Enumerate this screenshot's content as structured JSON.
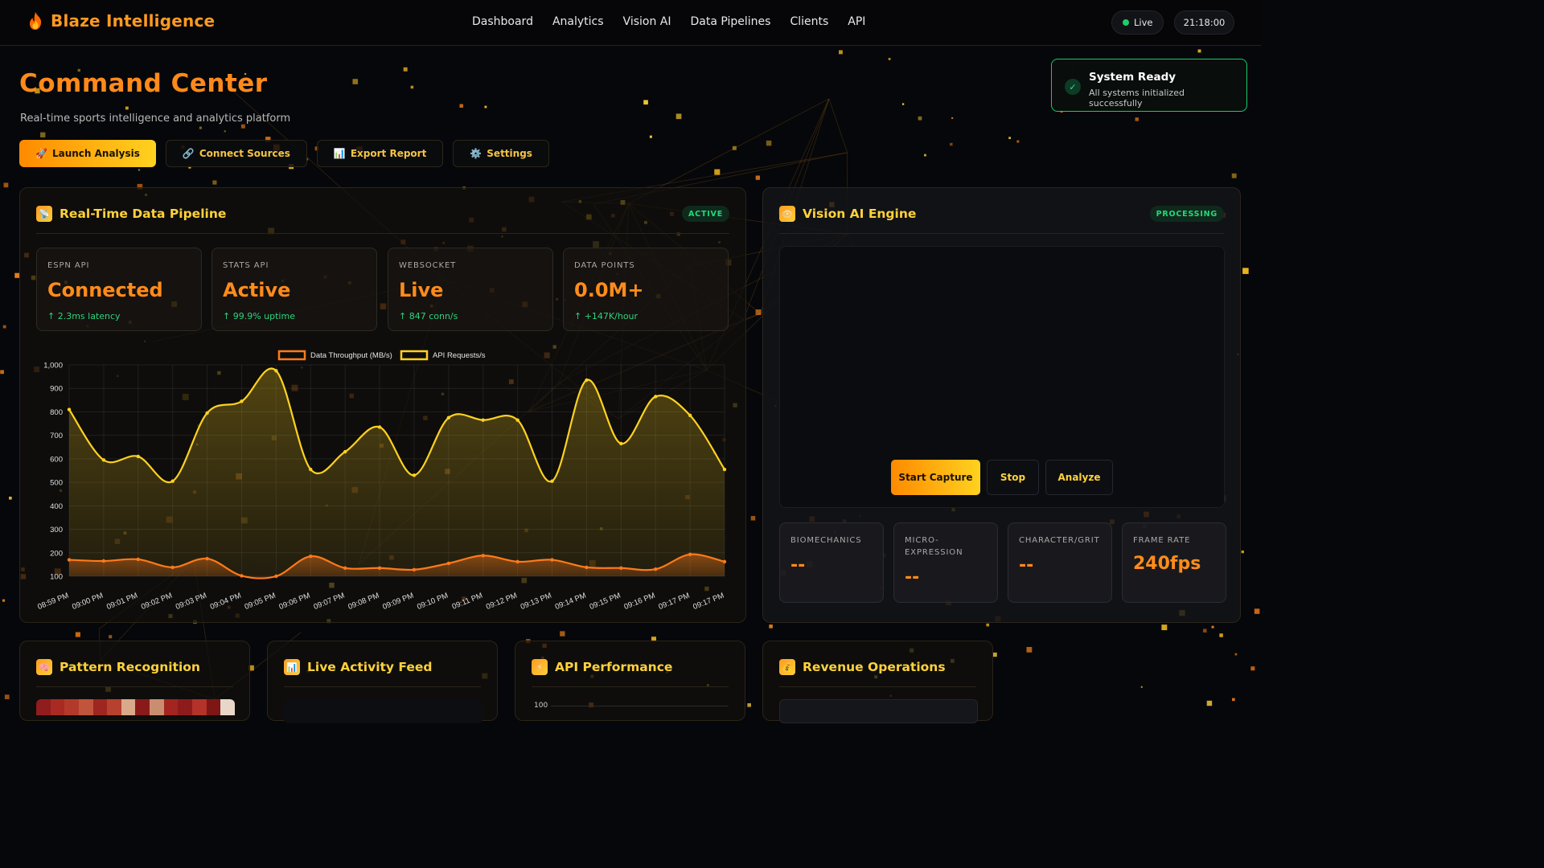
{
  "brand": {
    "name": "Blaze Intelligence"
  },
  "nav": {
    "links": [
      "Dashboard",
      "Analytics",
      "Vision AI",
      "Data Pipelines",
      "Clients",
      "API"
    ],
    "status": "Live",
    "clock": "21:18:00"
  },
  "hero": {
    "title": "Command Center",
    "subtitle": "Real-time sports intelligence and analytics platform",
    "actions": [
      {
        "icon": "rocket-icon",
        "label": "Launch Analysis"
      },
      {
        "icon": "link-icon",
        "label": "Connect Sources"
      },
      {
        "icon": "bar-chart-icon",
        "label": "Export Report"
      },
      {
        "icon": "gear-icon",
        "label": "Settings"
      }
    ]
  },
  "toast": {
    "title": "System Ready",
    "message": "All systems initialized successfully"
  },
  "pipeline": {
    "title": "Real-Time Data Pipeline",
    "badge": "ACTIVE",
    "metrics": [
      {
        "label": "ESPN API",
        "value": "Connected",
        "change": "↑ 2.3ms latency"
      },
      {
        "label": "STATS API",
        "value": "Active",
        "change": "↑ 99.9% uptime"
      },
      {
        "label": "WEBSOCKET",
        "value": "Live",
        "change": "↑ 847 conn/s"
      },
      {
        "label": "DATA POINTS",
        "value": "0.0M+",
        "change": "↑ +147K/hour"
      }
    ]
  },
  "vision": {
    "title": "Vision AI Engine",
    "badge": "PROCESSING",
    "buttons": {
      "start": "Start Capture",
      "stop": "Stop",
      "analyze": "Analyze"
    },
    "stats": [
      {
        "label": "BIOMECHANICS",
        "value": "--"
      },
      {
        "label": "MICRO-EXPRESSION",
        "value": "--"
      },
      {
        "label": "CHARACTER/GRIT",
        "value": "--"
      },
      {
        "label": "FRAME RATE",
        "value": "240fps"
      }
    ]
  },
  "bottom_panels": [
    {
      "icon": "brain-icon",
      "title": "Pattern Recognition"
    },
    {
      "icon": "bar-chart-icon",
      "title": "Live Activity Feed"
    },
    {
      "icon": "lightning-icon",
      "title": "API Performance",
      "axis_top": "100"
    },
    {
      "icon": "money-bag-icon",
      "title": "Revenue Operations"
    }
  ],
  "colors": {
    "accent": "#ff8a1a",
    "title_yellow": "#ffd23a",
    "success": "#23d97a"
  },
  "chart_data": {
    "type": "line",
    "title": "",
    "categories": [
      "08:59 PM",
      "09:00 PM",
      "09:01 PM",
      "09:02 PM",
      "09:03 PM",
      "09:04 PM",
      "09:05 PM",
      "09:06 PM",
      "09:07 PM",
      "09:08 PM",
      "09:09 PM",
      "09:10 PM",
      "09:11 PM",
      "09:12 PM",
      "09:13 PM",
      "09:14 PM",
      "09:15 PM",
      "09:16 PM",
      "09:17 PM",
      "09:17 PM"
    ],
    "series": [
      {
        "name": "Data Throughput (MB/s)",
        "color": "#ff7a1a",
        "values": [
          170,
          165,
          172,
          138,
          175,
          102,
          100,
          185,
          135,
          135,
          128,
          155,
          188,
          162,
          170,
          138,
          135,
          130,
          193,
          162
        ]
      },
      {
        "name": "API Requests/s",
        "color": "#ffd21f",
        "values": [
          810,
          595,
          610,
          505,
          795,
          845,
          975,
          555,
          630,
          735,
          530,
          775,
          765,
          765,
          505,
          935,
          665,
          865,
          785,
          555
        ]
      }
    ],
    "ylim": [
      100,
      1000
    ],
    "yticks": [
      "1,000",
      "900",
      "800",
      "700",
      "600",
      "500",
      "400",
      "300",
      "200",
      "100"
    ],
    "legend": "top-center",
    "grid": true
  }
}
